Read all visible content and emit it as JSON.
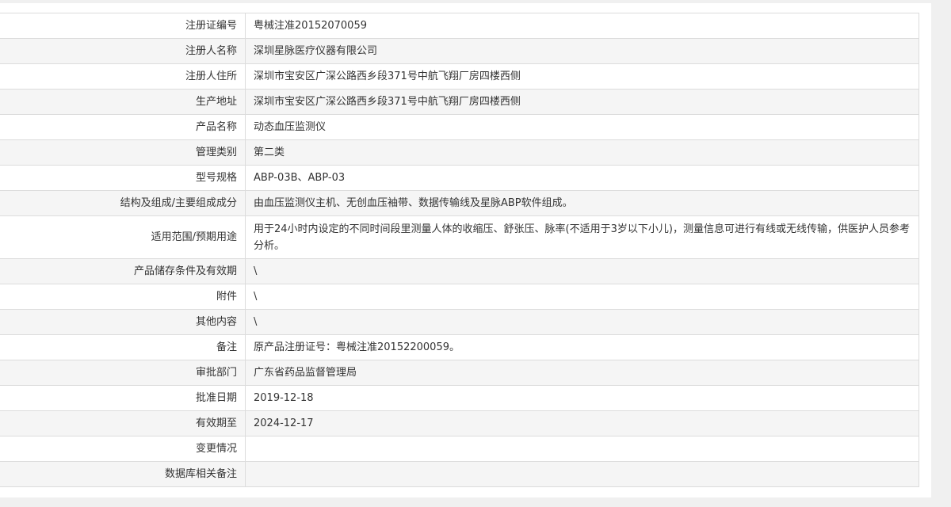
{
  "rows": [
    {
      "label": "注册证编号",
      "value": "粤械注准20152070059"
    },
    {
      "label": "注册人名称",
      "value": "深圳星脉医疗仪器有限公司"
    },
    {
      "label": "注册人住所",
      "value": "深圳市宝安区广深公路西乡段371号中航飞翔厂房四楼西侧"
    },
    {
      "label": "生产地址",
      "value": "深圳市宝安区广深公路西乡段371号中航飞翔厂房四楼西侧"
    },
    {
      "label": "产品名称",
      "value": "动态血压监测仪"
    },
    {
      "label": "管理类别",
      "value": "第二类"
    },
    {
      "label": "型号规格",
      "value": "ABP-03B、ABP-03"
    },
    {
      "label": "结构及组成/主要组成成分",
      "value": "由血压监测仪主机、无创血压袖带、数据传输线及星脉ABP软件组成。"
    },
    {
      "label": "适用范围/预期用途",
      "value": "用于24小时内设定的不同时间段里测量人体的收缩压、舒张压、脉率(不适用于3岁以下小儿)，测量信息可进行有线或无线传输，供医护人员参考分析。"
    },
    {
      "label": "产品储存条件及有效期",
      "value": "\\"
    },
    {
      "label": "附件",
      "value": "\\"
    },
    {
      "label": "其他内容",
      "value": "\\"
    },
    {
      "label": "备注",
      "value": "原产品注册证号：粤械注准20152200059。"
    },
    {
      "label": "审批部门",
      "value": "广东省药品监督管理局"
    },
    {
      "label": "批准日期",
      "value": "2019-12-18"
    },
    {
      "label": "有效期至",
      "value": "2024-12-17"
    },
    {
      "label": "变更情况",
      "value": ""
    },
    {
      "label": "数据库相关备注",
      "value": ""
    }
  ]
}
